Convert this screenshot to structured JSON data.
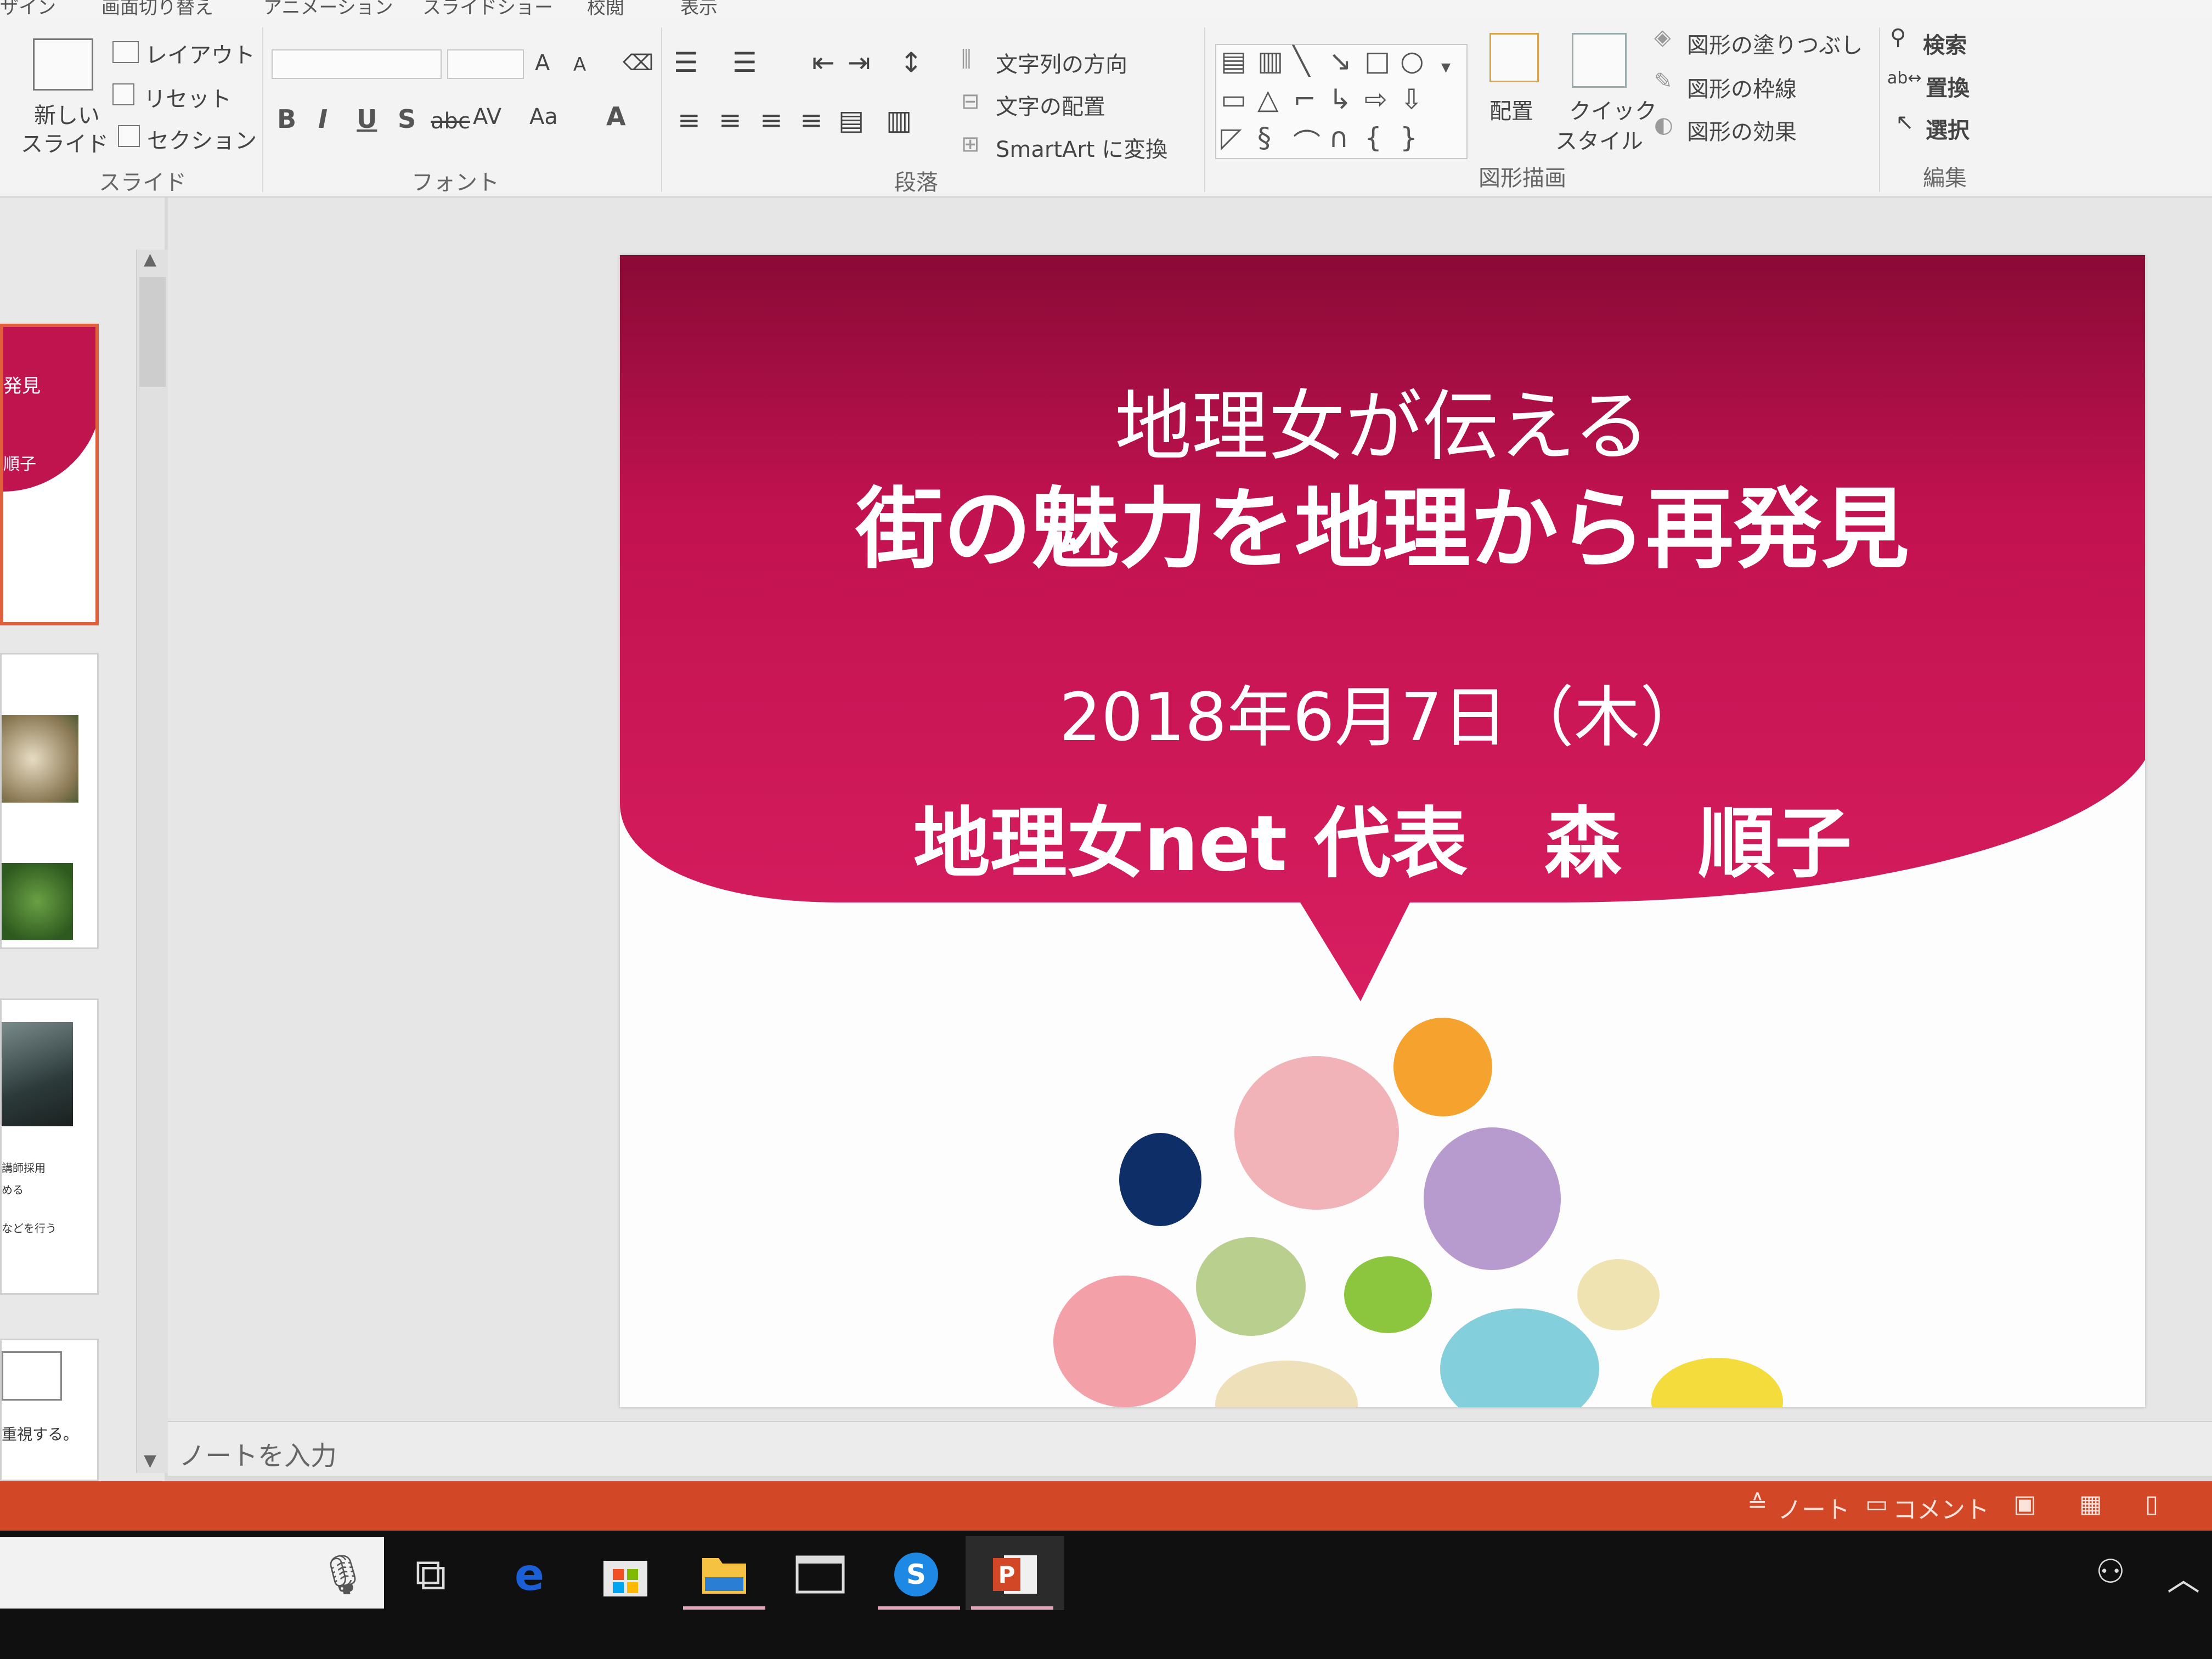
{
  "ribbon": {
    "tabs": [
      "ザイン",
      "画面切り替え",
      "アニメーション",
      "スライドショー",
      "校閲",
      "表示"
    ],
    "slides_group": {
      "new_slide_line1": "新しい",
      "new_slide_line2": "スライド",
      "layout": "レイアウト",
      "reset": "リセット",
      "section": "セクション",
      "label": "スライド"
    },
    "font_group": {
      "label": "フォント",
      "grow": "A",
      "shrink": "A",
      "bold": "B",
      "italic": "I",
      "underline": "U",
      "shadow": "S",
      "strike": "abc",
      "spacing": "AV",
      "case": "Aa",
      "color": "A"
    },
    "paragraph_group": {
      "label": "段落",
      "text_direction": "文字列の方向",
      "align_text": "文字の配置",
      "smartart": "SmartArt に変換"
    },
    "drawing_group": {
      "label": "図形描画",
      "arrange": "配置",
      "quick_styles_line1": "クイック",
      "quick_styles_line2": "スタイル",
      "shape_fill": "図形の塗りつぶし",
      "shape_outline": "図形の枠線",
      "shape_effects": "図形の効果"
    },
    "editing_group": {
      "label": "編集",
      "find": "検索",
      "replace": "置換",
      "select": "選択"
    }
  },
  "thumbnails": {
    "slide1_text_a": "発見",
    "slide1_text_b": "順子",
    "slide4_text_a": "講師採用",
    "slide4_text_b": "める",
    "slide4_text_c": "などを行う",
    "slide5_text": "重視する。"
  },
  "slide": {
    "title_line1": "地理女が伝える",
    "title_line2": "街の魅力を地理から再発見",
    "date": "2018年6月7日（木）",
    "presenter": "地理女net 代表　森　順子",
    "accent_color": "#c8124f"
  },
  "notes": {
    "placeholder": "ノートを入力"
  },
  "statusbar": {
    "notes": "ノート",
    "comments": "コメント",
    "color": "#d24726"
  },
  "taskbar": {
    "icons": [
      "microphone-icon",
      "task-view-icon",
      "edge-icon",
      "store-icon",
      "file-explorer-icon",
      "window-icon",
      "skype-icon",
      "powerpoint-icon"
    ]
  }
}
